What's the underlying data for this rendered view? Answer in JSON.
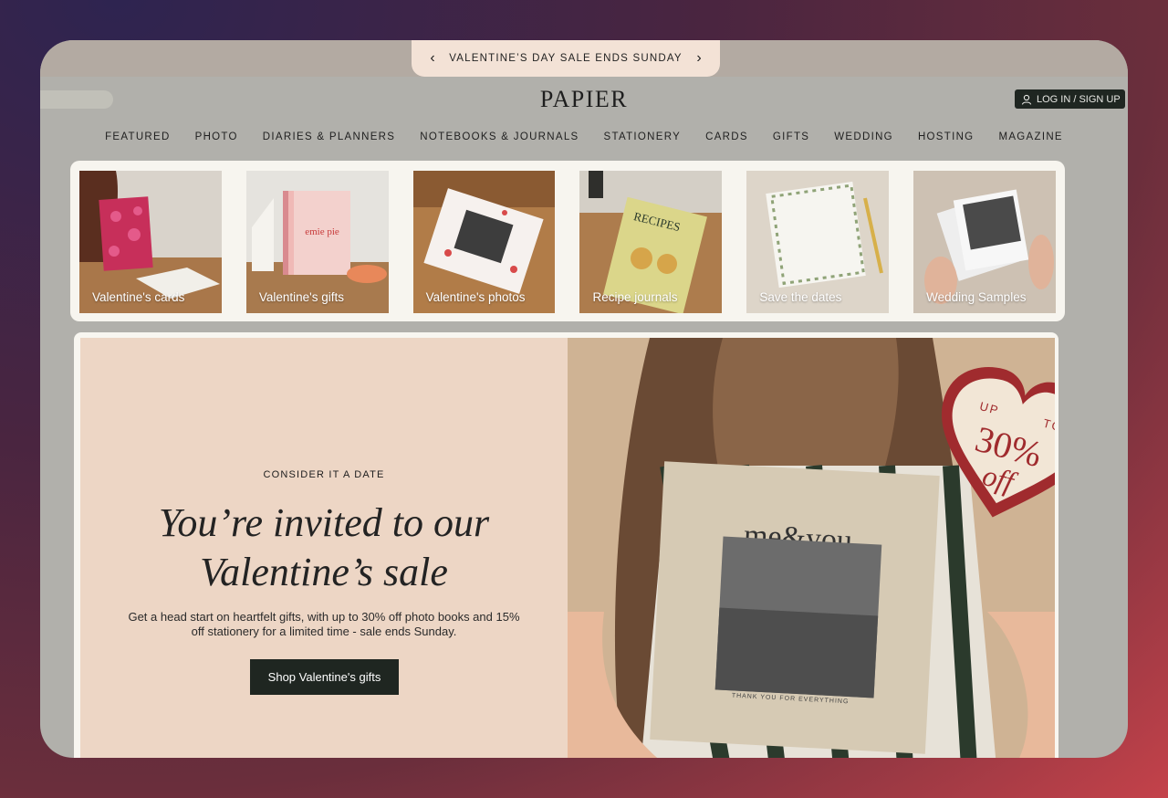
{
  "promo": {
    "prev_icon": "chevron-left-icon",
    "message": "VALENTINE’S DAY SALE ENDS SUNDAY",
    "next_icon": "chevron-right-icon"
  },
  "header": {
    "logo": "PAPIER",
    "login_label": "LOG IN / SIGN UP",
    "login_icon": "user-icon"
  },
  "nav": [
    "FEATURED",
    "PHOTO",
    "DIARIES & PLANNERS",
    "NOTEBOOKS & JOURNALS",
    "STATIONERY",
    "CARDS",
    "GIFTS",
    "WEDDING",
    "HOSTING",
    "MAGAZINE"
  ],
  "categories": [
    {
      "label": "Valentine's cards"
    },
    {
      "label": "Valentine's gifts",
      "book_title": "emie pie"
    },
    {
      "label": "Valentine's photos"
    },
    {
      "label": "Recipe journals",
      "book_title": "RECIPES"
    },
    {
      "label": "Save the dates"
    },
    {
      "label": "Wedding Samples"
    }
  ],
  "hero": {
    "eyebrow": "CONSIDER IT A DATE",
    "headline_line1": "You’re invited to our",
    "headline_line2": "Valentine’s sale",
    "subtext": "Get a head start on heartfelt gifts, with up to 30% off photo books and 15% off stationery for a limited time - sale ends Sunday.",
    "cta_label": "Shop Valentine's gifts",
    "book_title": "me&you",
    "book_caption": "THANK YOU FOR EVERYTHING",
    "badge_up": "UP",
    "badge_to": "TO",
    "badge_pct": "30%",
    "badge_off": "off"
  },
  "colors": {
    "dark_button": "#1f2621",
    "hero_panel": "#edd6c5",
    "promo_bg": "#f3e2d6",
    "badge_red": "#9a2a2a"
  }
}
